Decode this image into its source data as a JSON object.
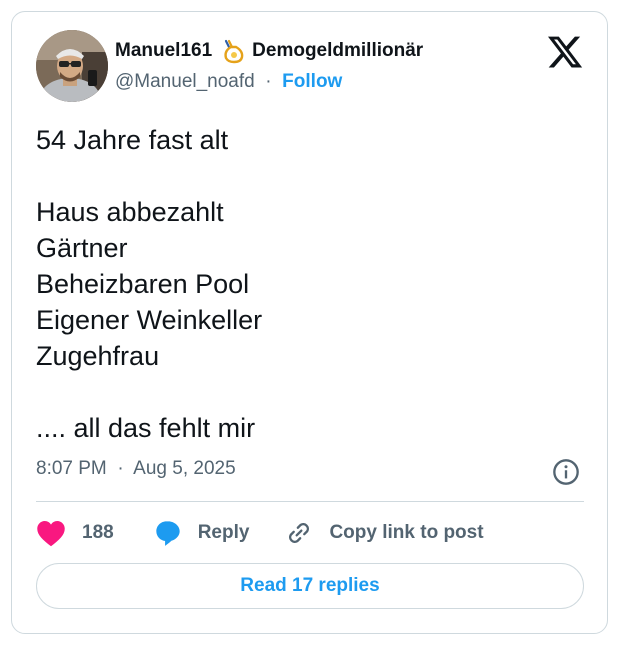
{
  "author": {
    "name": "Manuel161",
    "badge_icon": "money-bag-icon",
    "affiliation": "Demogeldmillionär",
    "handle": "@Manuel_noafd",
    "separator": "·",
    "follow_label": "Follow"
  },
  "platform_icon": "x-logo-icon",
  "tweet": {
    "lines": [
      "54 Jahre fast alt",
      "",
      "Haus abbezahlt",
      "Gärtner",
      "Beheizbaren Pool",
      "Eigener Weinkeller",
      "Zugehfrau",
      "",
      ".... all das fehlt mir"
    ]
  },
  "meta": {
    "time": "8:07 PM",
    "separator": "·",
    "date": "Aug 5, 2025"
  },
  "actions": {
    "like_count": "188",
    "reply_label": "Reply",
    "copy_label": "Copy link to post"
  },
  "read_replies_label": "Read 17 replies",
  "colors": {
    "accent": "#1d9bf0",
    "like": "#f91880",
    "text": "#0f1419",
    "secondary_text": "#536471",
    "border": "#cfd9de"
  }
}
